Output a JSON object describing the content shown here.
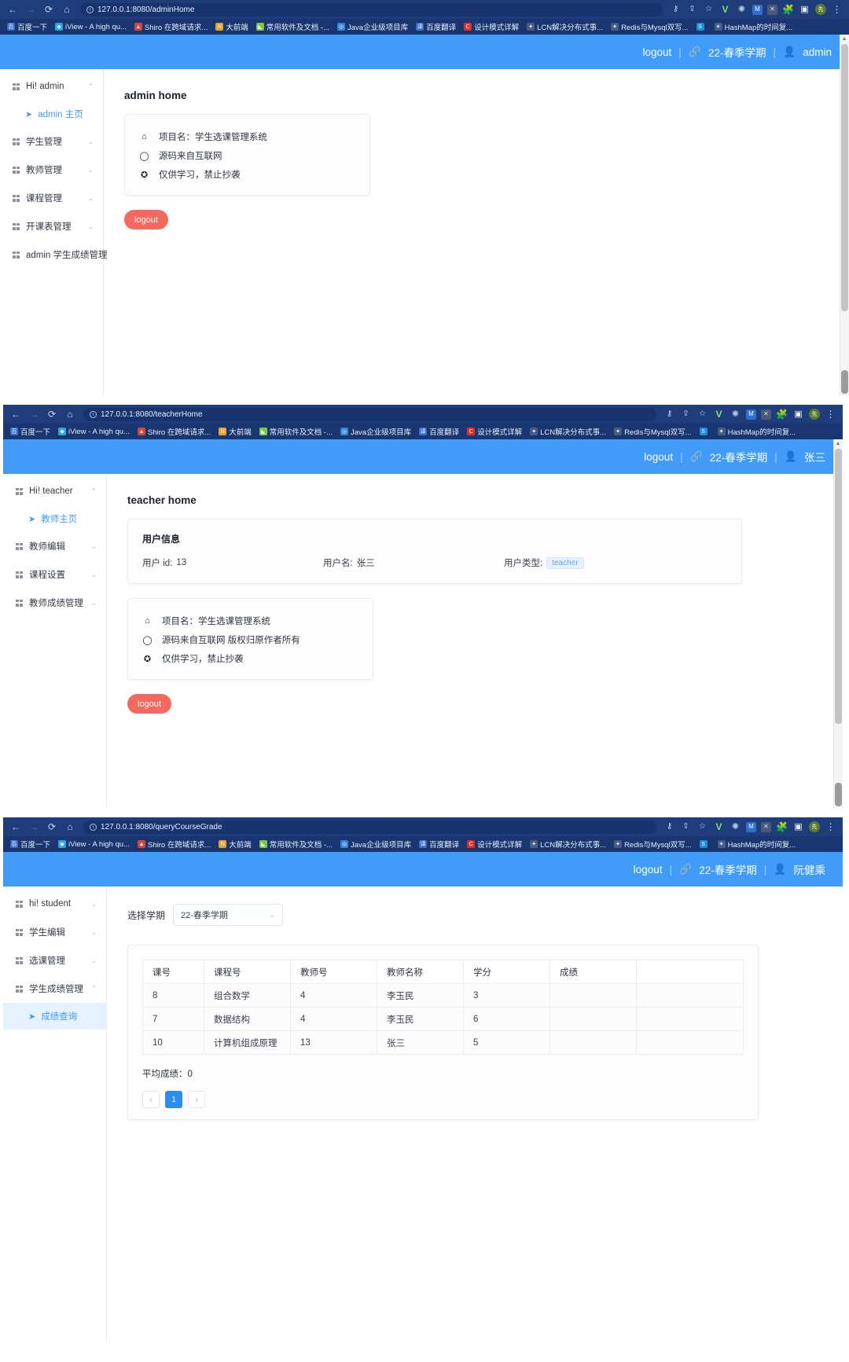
{
  "browser": {
    "nav": {
      "back": "←",
      "forward": "→",
      "reload": "⟳",
      "home": "⌂"
    },
    "actions": [
      "key-icon",
      "share-icon",
      "star-icon",
      "v-extension-icon",
      "gear-extension-icon",
      "m-extension-icon",
      "x-extension-icon",
      "puzzle-icon",
      "sidepanel-icon",
      "profile-avatar",
      "kebab-menu-icon"
    ],
    "bookmarks": [
      {
        "label": "百度一下",
        "color": "#3b6ecb",
        "glyph": "百"
      },
      {
        "label": "iView - A high qu...",
        "color": "#2aa8e0",
        "glyph": "◆"
      },
      {
        "label": "Shiro 在跨域请求...",
        "color": "#d9443a",
        "glyph": "▲"
      },
      {
        "label": "大前端",
        "color": "#e2a32b",
        "glyph": "N"
      },
      {
        "label": "常用软件及文档 -...",
        "color": "#7ac943",
        "glyph": "◣"
      },
      {
        "label": "Java企业级项目库",
        "color": "#2f86d8",
        "glyph": "◎"
      },
      {
        "label": "百度翻译",
        "color": "#3b6ecb",
        "glyph": "译"
      },
      {
        "label": "设计模式详解",
        "color": "#e03127",
        "glyph": "C"
      },
      {
        "label": "LCN解决分布式事...",
        "color": "#4a5c85",
        "glyph": "✦"
      },
      {
        "label": "Redis与Mysql双写...",
        "color": "#4a5c85",
        "glyph": "✦"
      },
      {
        "label": "",
        "color": "#1b8fd6",
        "glyph": "S"
      },
      {
        "label": "HashMap的时间复...",
        "color": "#4a5c85",
        "glyph": "✦"
      }
    ]
  },
  "panels": [
    {
      "url": "127.0.0.1:8080/adminHome",
      "header": {
        "logout": "logout",
        "link_icon": "link-icon",
        "term": "22-春季学期",
        "user_icon": "user-icon",
        "user": "admin"
      },
      "sidebar": [
        {
          "type": "group",
          "label": "Hi! admin",
          "expanded": true,
          "chevron": "⌃"
        },
        {
          "type": "sub",
          "label": "admin 主页",
          "active": false,
          "icon": "paper-plane-icon"
        },
        {
          "type": "group",
          "label": "学生管理",
          "expanded": false,
          "chevron": "⌄"
        },
        {
          "type": "group",
          "label": "教师管理",
          "expanded": false,
          "chevron": "⌄"
        },
        {
          "type": "group",
          "label": "课程管理",
          "expanded": false,
          "chevron": "⌄"
        },
        {
          "type": "group",
          "label": "开课表管理",
          "expanded": false,
          "chevron": "⌄"
        },
        {
          "type": "group",
          "label": "admin 学生成绩管理",
          "expanded": false,
          "chevron": ""
        }
      ],
      "page_title": "admin home",
      "info_card": [
        {
          "icon": "home-icon",
          "glyph": "⌂",
          "text": "项目名：学生选课管理系统"
        },
        {
          "icon": "comment-icon",
          "glyph": "◯",
          "text": "源码来自互联网"
        },
        {
          "icon": "ban-icon",
          "glyph": "✪",
          "text": "仅供学习，禁止抄袭"
        }
      ],
      "logout_button": "logout"
    },
    {
      "url": "127.0.0.1:8080/teacherHome",
      "header": {
        "logout": "logout",
        "link_icon": "link-icon",
        "term": "22-春季学期",
        "user_icon": "user-icon",
        "user": "张三"
      },
      "sidebar": [
        {
          "type": "group",
          "label": "Hi! teacher",
          "expanded": true,
          "chevron": "⌃"
        },
        {
          "type": "sub",
          "label": "教师主页",
          "active": false,
          "icon": "paper-plane-icon"
        },
        {
          "type": "group",
          "label": "教师编辑",
          "expanded": false,
          "chevron": "⌄"
        },
        {
          "type": "group",
          "label": "课程设置",
          "expanded": false,
          "chevron": "⌄"
        },
        {
          "type": "group",
          "label": "教师成绩管理",
          "expanded": false,
          "chevron": "⌄"
        }
      ],
      "page_title": "teacher home",
      "user_card": {
        "title": "用户信息",
        "id_label": "用户 id:",
        "id_value": "13",
        "name_label": "用户名:",
        "name_value": "张三",
        "type_label": "用户类型:",
        "type_value": "teacher"
      },
      "info_card": [
        {
          "icon": "home-icon",
          "glyph": "⌂",
          "text": "项目名：学生选课管理系统"
        },
        {
          "icon": "comment-icon",
          "glyph": "◯",
          "text": "源码来自互联网 版权归原作者所有"
        },
        {
          "icon": "ban-icon",
          "glyph": "✪",
          "text": "仅供学习，禁止抄袭"
        }
      ],
      "logout_button": "logout"
    },
    {
      "url": "127.0.0.1:8080/queryCourseGrade",
      "header": {
        "logout": "logout",
        "link_icon": "link-icon",
        "term": "22-春季学期",
        "user_icon": "user-icon",
        "user": "阮健乘"
      },
      "sidebar": [
        {
          "type": "group",
          "label": "hi! student",
          "expanded": false,
          "chevron": "⌄"
        },
        {
          "type": "group",
          "label": "学生编辑",
          "expanded": false,
          "chevron": "⌄"
        },
        {
          "type": "group",
          "label": "选课管理",
          "expanded": false,
          "chevron": "⌄"
        },
        {
          "type": "group",
          "label": "学生成绩管理",
          "expanded": true,
          "chevron": "⌃"
        },
        {
          "type": "sub",
          "label": "成绩查询",
          "active": true,
          "icon": "paper-plane-icon"
        }
      ],
      "select": {
        "label": "选择学期",
        "value": "22-春季学期",
        "chevron": "⌄"
      },
      "table": {
        "columns": [
          "课号",
          "课程号",
          "教师号",
          "教师名称",
          "学分",
          "成绩",
          ""
        ],
        "rows": [
          [
            "8",
            "组合数学",
            "4",
            "李玉民",
            "3",
            "",
            ""
          ],
          [
            "7",
            "数据结构",
            "4",
            "李玉民",
            "6",
            "",
            ""
          ],
          [
            "10",
            "计算机组成原理",
            "13",
            "张三",
            "5",
            "",
            ""
          ]
        ]
      },
      "average": "平均成绩：0",
      "pager": {
        "prev": "‹",
        "pages": [
          "1"
        ],
        "next": "›"
      }
    }
  ],
  "colors": {
    "app_header": "#419bf9",
    "chrome": "#1f3d7a",
    "bookmarks_bar": "#1a3670",
    "accent_link": "#429bf9",
    "logout_button": "#f4685f",
    "pager_active": "#2d8cf0",
    "tag_teacher_bg": "#e7f2fe"
  }
}
